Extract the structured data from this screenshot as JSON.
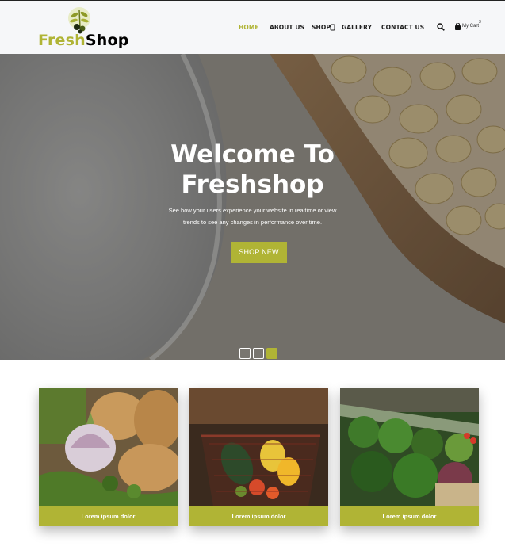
{
  "header": {
    "logo": {
      "part1": "Fresh",
      "part2": "Shop"
    },
    "nav": [
      {
        "label": "HOME",
        "active": true
      },
      {
        "label": "ABOUT US",
        "active": false
      },
      {
        "label": "SHOP",
        "active": false,
        "has_dropdown": true
      },
      {
        "label": "GALLERY",
        "active": false
      },
      {
        "label": "CONTACT US",
        "active": false
      }
    ],
    "search_icon": "search-icon",
    "cart": {
      "label": "My Cart",
      "count": "3"
    }
  },
  "hero": {
    "title_line1": "Welcome To",
    "title_line2": "Freshshop",
    "subtitle_line1": "See how your users experience your website in realtime or view",
    "subtitle_line2": "trends to see any changes in performance over time.",
    "button": "SHOP NEW",
    "slides": 3,
    "active_slide": 3
  },
  "cards": [
    {
      "label": "Lorem ipsum dolor",
      "image": "garlic and potatoes"
    },
    {
      "label": "Lorem ipsum dolor",
      "image": "vegetable basket"
    },
    {
      "label": "Lorem ipsum dolor",
      "image": "produce market shelf"
    }
  ],
  "colors": {
    "accent": "#b0b435",
    "nav_bg": "#f6f7f9",
    "text_dark": "#222222"
  }
}
